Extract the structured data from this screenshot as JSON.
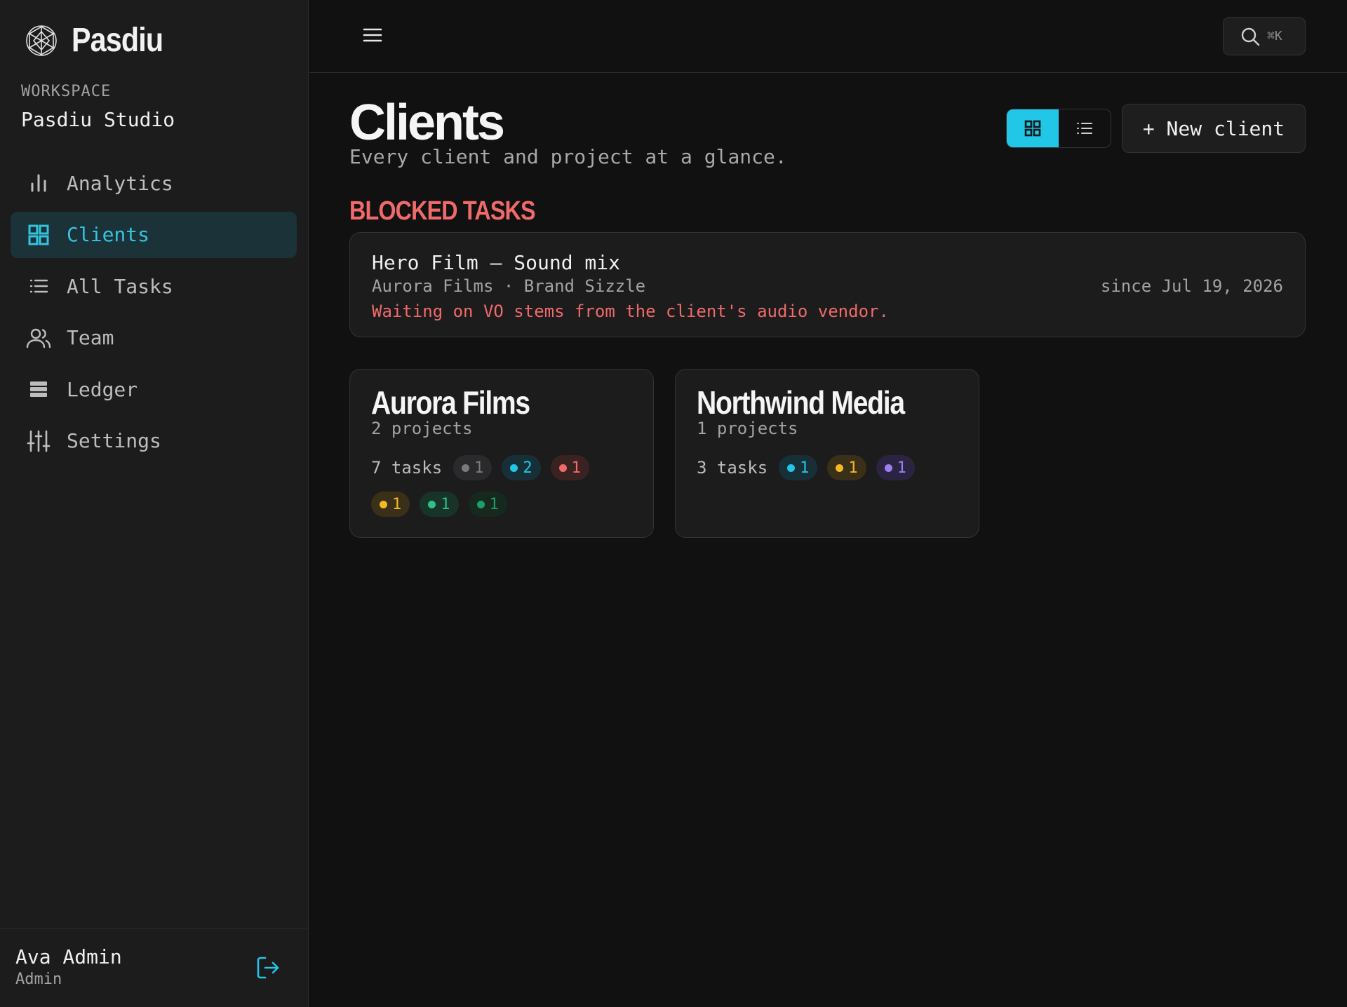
{
  "app": {
    "name": "Pasdiu"
  },
  "workspace": {
    "label": "WORKSPACE",
    "name": "Pasdiu Studio"
  },
  "nav": [
    {
      "label": "Analytics",
      "icon": "bar-chart-icon",
      "active": false
    },
    {
      "label": "Clients",
      "icon": "grid-icon",
      "active": true
    },
    {
      "label": "All Tasks",
      "icon": "list-icon",
      "active": false
    },
    {
      "label": "Team",
      "icon": "users-icon",
      "active": false
    },
    {
      "label": "Ledger",
      "icon": "ledger-icon",
      "active": false
    },
    {
      "label": "Settings",
      "icon": "sliders-icon",
      "active": false
    }
  ],
  "user": {
    "name": "Ava Admin",
    "role": "Admin"
  },
  "topbar": {
    "search_shortcut": "⌘K"
  },
  "page": {
    "title": "Clients",
    "subtitle": "Every client and project at a glance.",
    "new_button": "+ New client"
  },
  "blocked": {
    "heading": "BLOCKED TASKS",
    "items": [
      {
        "title": "Hero Film — Sound mix",
        "meta": "Aurora Films · Brand Sizzle",
        "since": "since Jul 19, 2026",
        "note": "Waiting on VO stems from the client's audio vendor."
      }
    ]
  },
  "clients": [
    {
      "name": "Aurora Films",
      "projects": "2 projects",
      "tasks": "7 tasks",
      "pills": [
        {
          "count": "1",
          "color": "#7a7a7e",
          "bg": "#2a2a2c"
        },
        {
          "count": "2",
          "color": "#22c6e6",
          "bg": "#173038"
        },
        {
          "count": "1",
          "color": "#f06a6a",
          "bg": "#3a2222"
        },
        {
          "count": "1",
          "color": "#f5b726",
          "bg": "#3a3018"
        },
        {
          "count": "1",
          "color": "#2fc089",
          "bg": "#183328"
        },
        {
          "count": "1",
          "color": "#1f9e68",
          "bg": "#17291f"
        }
      ]
    },
    {
      "name": "Northwind Media",
      "projects": "1 projects",
      "tasks": "3 tasks",
      "pills": [
        {
          "count": "1",
          "color": "#22c6e6",
          "bg": "#173038"
        },
        {
          "count": "1",
          "color": "#f5b726",
          "bg": "#3a3018"
        },
        {
          "count": "1",
          "color": "#9b7ff0",
          "bg": "#2a2440"
        }
      ]
    }
  ],
  "colors": {
    "accent": "#22c6e6",
    "danger": "#f06a6a",
    "bg": "#111112",
    "sidebar": "#1c1c1d"
  }
}
